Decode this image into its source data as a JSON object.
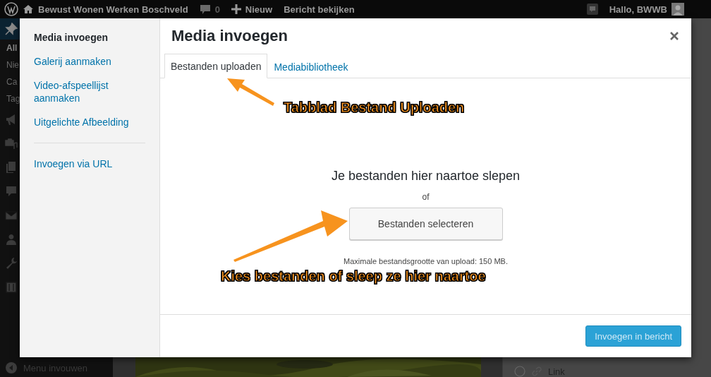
{
  "admin_bar": {
    "site_name": "Bewust Wonen Werken Boschveld",
    "comments_count": "0",
    "new_label": "Nieuw",
    "view_post": "Bericht bekijken",
    "greeting": "Hallo, BWWB"
  },
  "admin_menu": {
    "items": [
      {
        "kind": "icon",
        "selected": true
      },
      {
        "kind": "text",
        "label": "All",
        "selected": true
      },
      {
        "kind": "text",
        "label": "Nie",
        "selected": false
      },
      {
        "kind": "text",
        "label": "Ca",
        "selected": false
      },
      {
        "kind": "text",
        "label": "Tag",
        "selected": false
      },
      {
        "kind": "icon",
        "selected": false
      },
      {
        "kind": "icon",
        "selected": false
      },
      {
        "kind": "icon",
        "selected": false
      },
      {
        "kind": "icon",
        "selected": false
      },
      {
        "kind": "icon",
        "selected": false
      },
      {
        "kind": "icon",
        "selected": false
      },
      {
        "kind": "icon",
        "selected": false
      },
      {
        "kind": "icon",
        "selected": false
      }
    ],
    "collapse_label": "Menu invouwen"
  },
  "background": {
    "side_option": "Link"
  },
  "modal": {
    "title": "Media invoegen",
    "sidebar": [
      {
        "kind": "heading",
        "label": "Media invoegen",
        "selected": true
      },
      {
        "kind": "link",
        "label": "Galerij aanmaken",
        "selected": false
      },
      {
        "kind": "link",
        "label": "Video-afspeellijst aanmaken",
        "selected": false
      },
      {
        "kind": "link",
        "label": "Uitgelichte Afbeelding",
        "selected": false
      },
      {
        "kind": "separator"
      },
      {
        "kind": "link",
        "label": "Invoegen via URL",
        "selected": false
      }
    ],
    "tabs": [
      {
        "label": "Bestanden uploaden",
        "selected": true
      },
      {
        "label": "Mediabibliotheek",
        "selected": false
      }
    ],
    "upload": {
      "instructions": "Je bestanden hier naartoe slepen",
      "or": "of",
      "select_button": "Bestanden selecteren",
      "max_size": "Maximale bestandsgrootte van upload: 150 MB."
    },
    "insert_button": {
      "label": "Invoegen in bericht",
      "disabled": true
    }
  },
  "annotations": [
    {
      "text": "Tabblad Bestand Uploaden"
    },
    {
      "text": "Kies bestanden of sleep ze hier naartoe"
    }
  ]
}
